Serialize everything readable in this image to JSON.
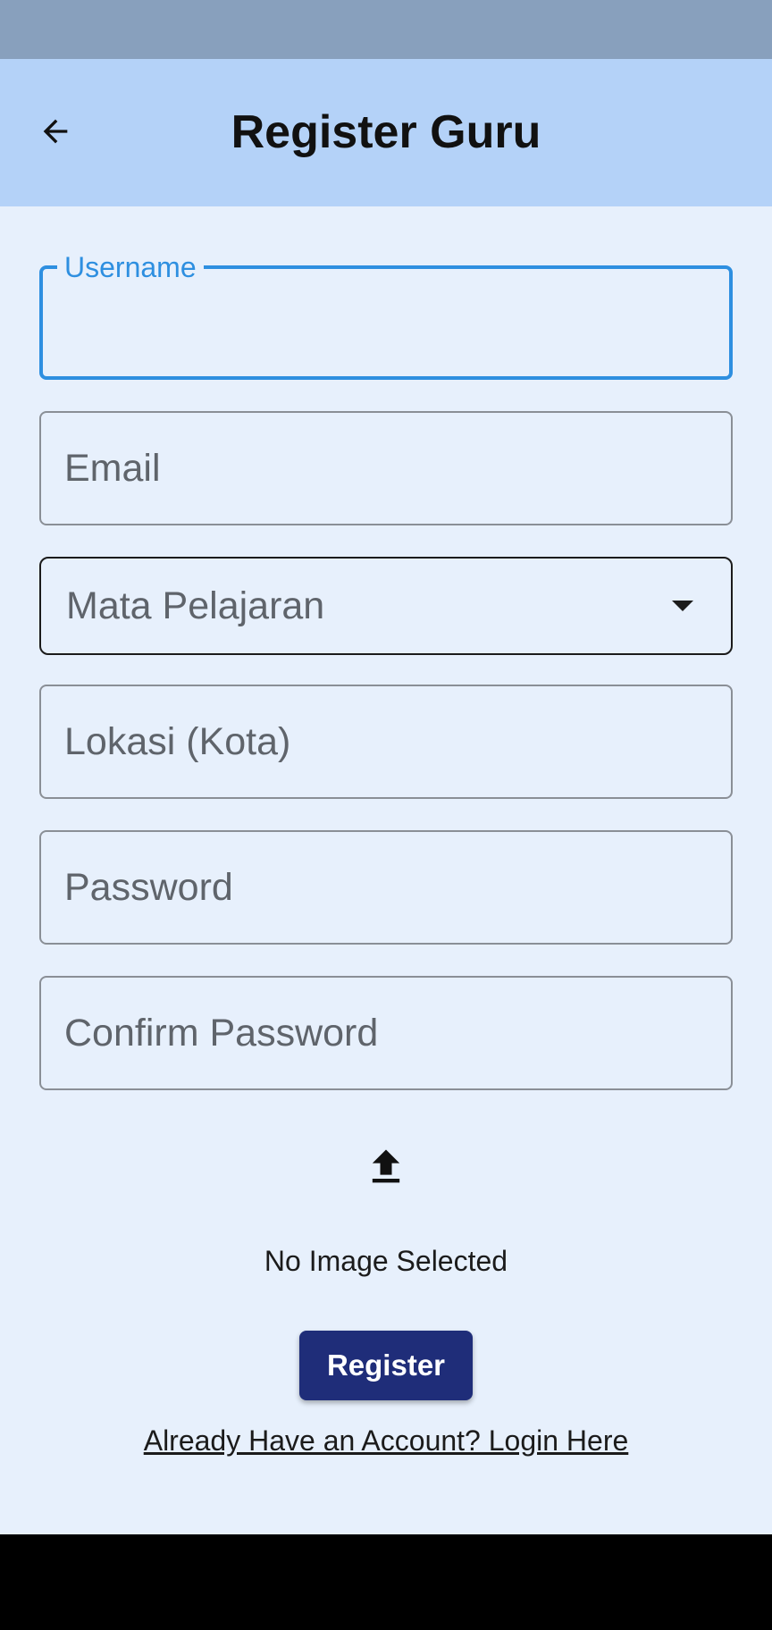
{
  "app_bar": {
    "title": "Register Guru",
    "back_icon": "arrow-left-icon"
  },
  "form": {
    "username_label": "Username",
    "username_value": "",
    "email_placeholder": "Email",
    "subject_placeholder": "Mata Pelajaran",
    "location_placeholder": "Lokasi (Kota)",
    "password_placeholder": "Password",
    "confirm_password_placeholder": "Confirm Password"
  },
  "upload": {
    "icon": "upload-icon",
    "status": "No Image Selected"
  },
  "actions": {
    "register_label": "Register",
    "login_link": "Already Have an Account? Login Here"
  },
  "colors": {
    "app_bar": "#b4d2f8",
    "background": "#e7f0fc",
    "focus": "#2e8fe0",
    "button": "#1f2d79"
  }
}
